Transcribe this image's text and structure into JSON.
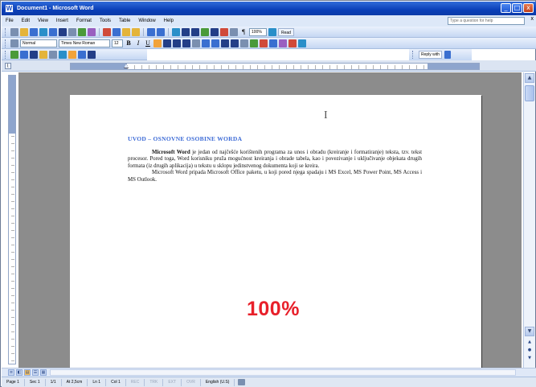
{
  "window": {
    "title": "Document1 - Microsoft Word",
    "app_letter": "W",
    "min_label": "_",
    "max_label": "□",
    "close_label": "x"
  },
  "menu": {
    "items": [
      "File",
      "Edit",
      "View",
      "Insert",
      "Format",
      "Tools",
      "Table",
      "Window",
      "Help"
    ],
    "help_placeholder": "Type a question for help",
    "close_doc": "x"
  },
  "toolbar": {
    "zoom_value": "100%",
    "read_label": "Read",
    "style_value": "Normal",
    "font_value": "Times New Roman",
    "size_value": "12",
    "bold": "B",
    "italic": "I",
    "underline": "U",
    "reply_label": "Reply with"
  },
  "document": {
    "heading": "UVOD – OSNOVNE OSOBINE WORDA",
    "para1_bold": "Microsoft Word",
    "para1_rest": " je jedan od najčešće korištenih programa za unos i obradu (kreiranje i formatiranje) teksta, tzv. tekst procesor. Pored toga, Word korisniku pruža mogućnost kreiranja i obrade tabela, kao i povezivanje i uključivanje objekata drugih formata (iz drugih aplikacija) u tekstu u sklopu jedinstvenog dokumenta koji se kreira.",
    "para2": "Microsoft Word pripada Microsoft Office paketu, u koji pored njega spadaju i MS Excel, MS Power Point, MS Access i MS Outlook.",
    "zoom_overlay": "100%"
  },
  "status": {
    "page": "Page 1",
    "section": "Sec 1",
    "page_of": "1/1",
    "at": "At 2,5cm",
    "line": "Ln 1",
    "col": "Col 1",
    "rec": "REC",
    "trk": "TRK",
    "ext": "EXT",
    "ovr": "OVR",
    "language": "English (U.S)"
  }
}
